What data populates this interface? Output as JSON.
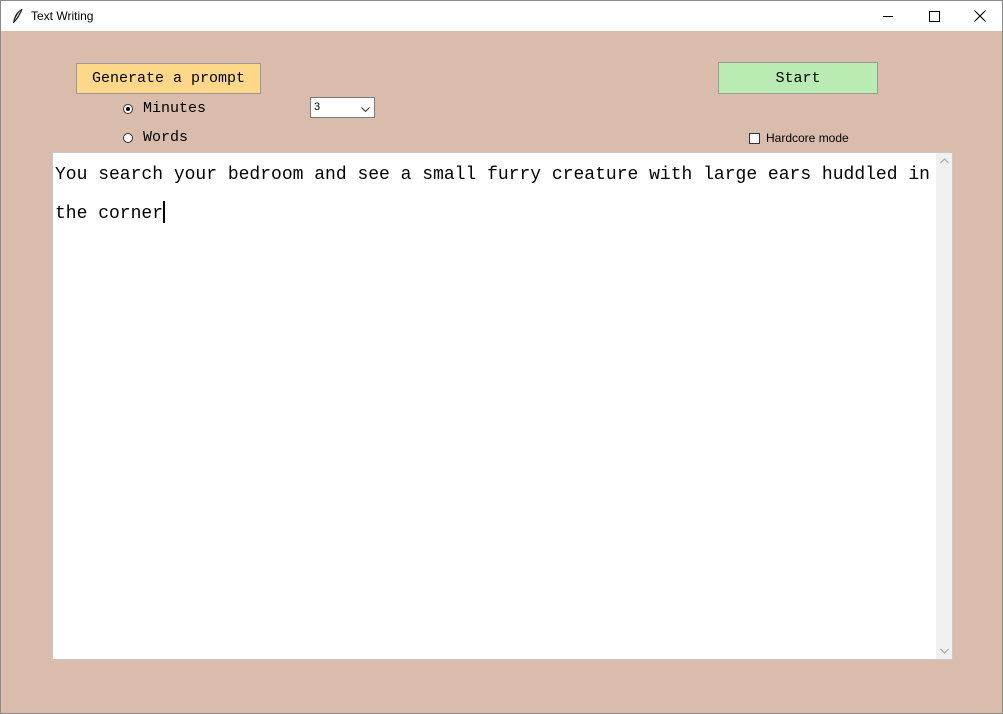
{
  "window": {
    "title": "Text Writing",
    "app_icon": "feather-icon",
    "controls": {
      "minimize_icon": "minimize-icon",
      "maximize_icon": "maximize-icon",
      "close_icon": "close-icon"
    }
  },
  "toolbar": {
    "generate_label": "Generate a prompt",
    "start_label": "Start"
  },
  "mode": {
    "minutes_label": "Minutes",
    "words_label": "Words",
    "selected": "Minutes",
    "amount_value": "3"
  },
  "options": {
    "hardcore_label": "Hardcore mode",
    "hardcore_checked": false
  },
  "editor": {
    "text": "You search your bedroom and see a small furry creature with large ears huddled in the corner"
  },
  "colors": {
    "background": "#d9bcab",
    "generate_button": "#fcd888",
    "start_button": "#b9ebb3"
  }
}
